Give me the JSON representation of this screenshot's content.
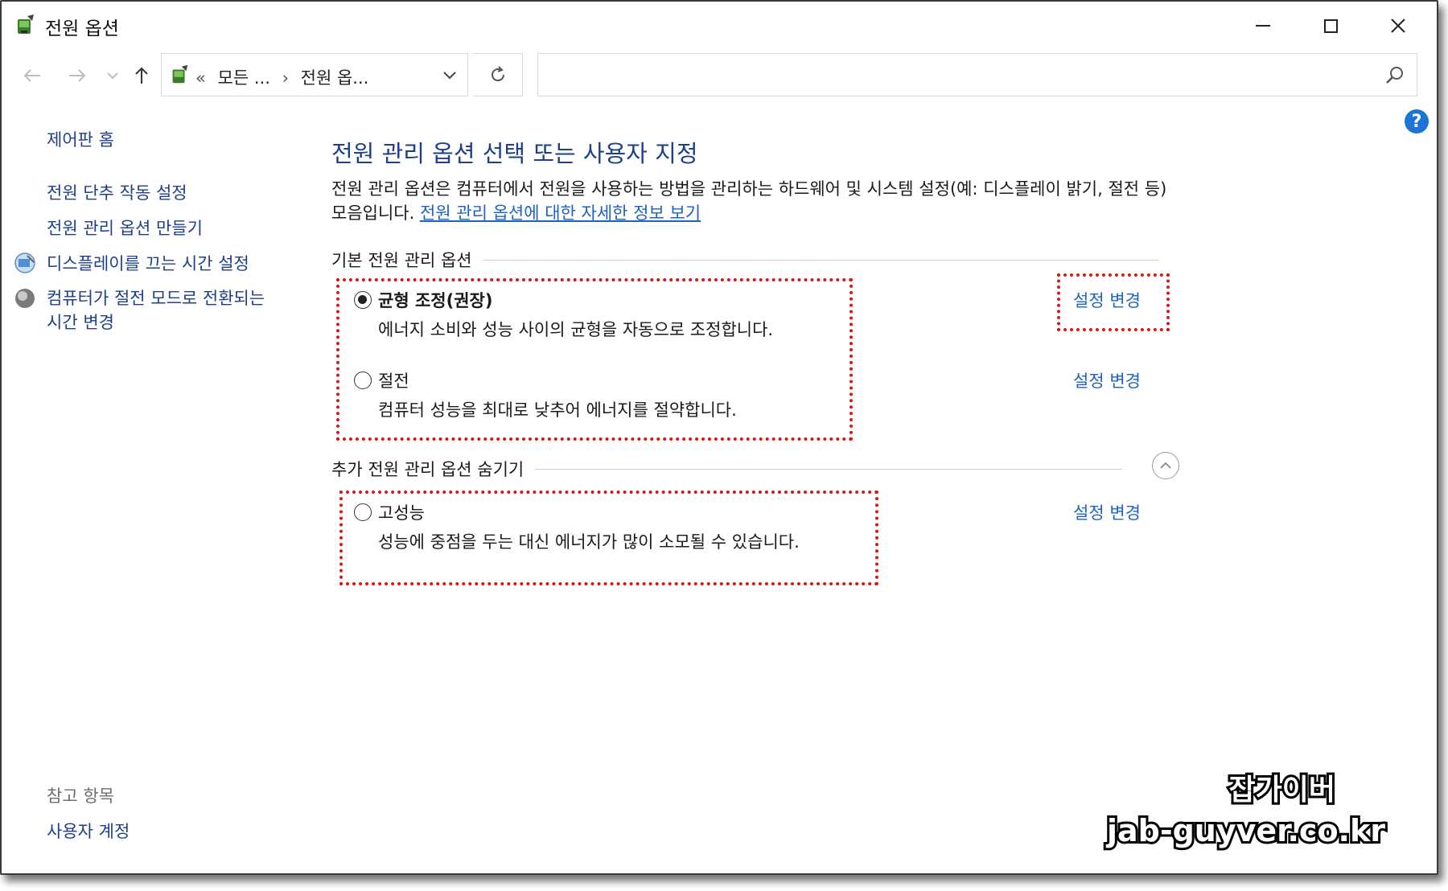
{
  "window": {
    "title": "전원 옵션"
  },
  "navigation": {
    "breadcrumb_prefix": "«",
    "breadcrumb_1": "모든 ...",
    "breadcrumb_sep": "›",
    "breadcrumb_2": "전원 옵...",
    "search_placeholder": ""
  },
  "sidebar": {
    "home": "제어판 홈",
    "items": [
      {
        "label": "전원 단추 작동 설정"
      },
      {
        "label": "전원 관리 옵션 만들기"
      },
      {
        "label": "디스플레이를 끄는 시간 설정"
      },
      {
        "label": "컴퓨터가 절전 모드로 전환되는 시간 변경"
      }
    ],
    "see_also_heading": "참고 항목",
    "see_also_items": [
      {
        "label": "사용자 계정"
      }
    ]
  },
  "main": {
    "title": "전원 관리 옵션 선택 또는 사용자 지정",
    "description": "전원 관리 옵션은 컴퓨터에서 전원을 사용하는 방법을 관리하는 하드웨어 및 시스템 설정(예: 디스플레이 밝기, 절전 등) 모음입니다. ",
    "description_link": "전원 관리 옵션에 대한 자세한 정보 보기",
    "preferred_heading": "기본 전원 관리 옵션",
    "additional_heading": "추가 전원 관리 옵션 숨기기",
    "change_label": "설정 변경",
    "plans": [
      {
        "name": "균형 조정(권장)",
        "description": "에너지 소비와 성능 사이의 균형을 자동으로 조정합니다.",
        "selected": true
      },
      {
        "name": "절전",
        "description": "컴퓨터 성능을 최대로 낮추어 에너지를 절약합니다.",
        "selected": false
      },
      {
        "name": "고성능",
        "description": "성능에 중점을 두는 대신 에너지가 많이 소모될 수 있습니다.",
        "selected": false
      }
    ]
  },
  "watermark": {
    "line1": "잡가이버",
    "line2": "jab-guyver.co.kr"
  },
  "colors": {
    "link": "#1c62c7",
    "heading": "#1e3f8a",
    "highlight": "#d21a1a",
    "help": "#1c74d6"
  }
}
